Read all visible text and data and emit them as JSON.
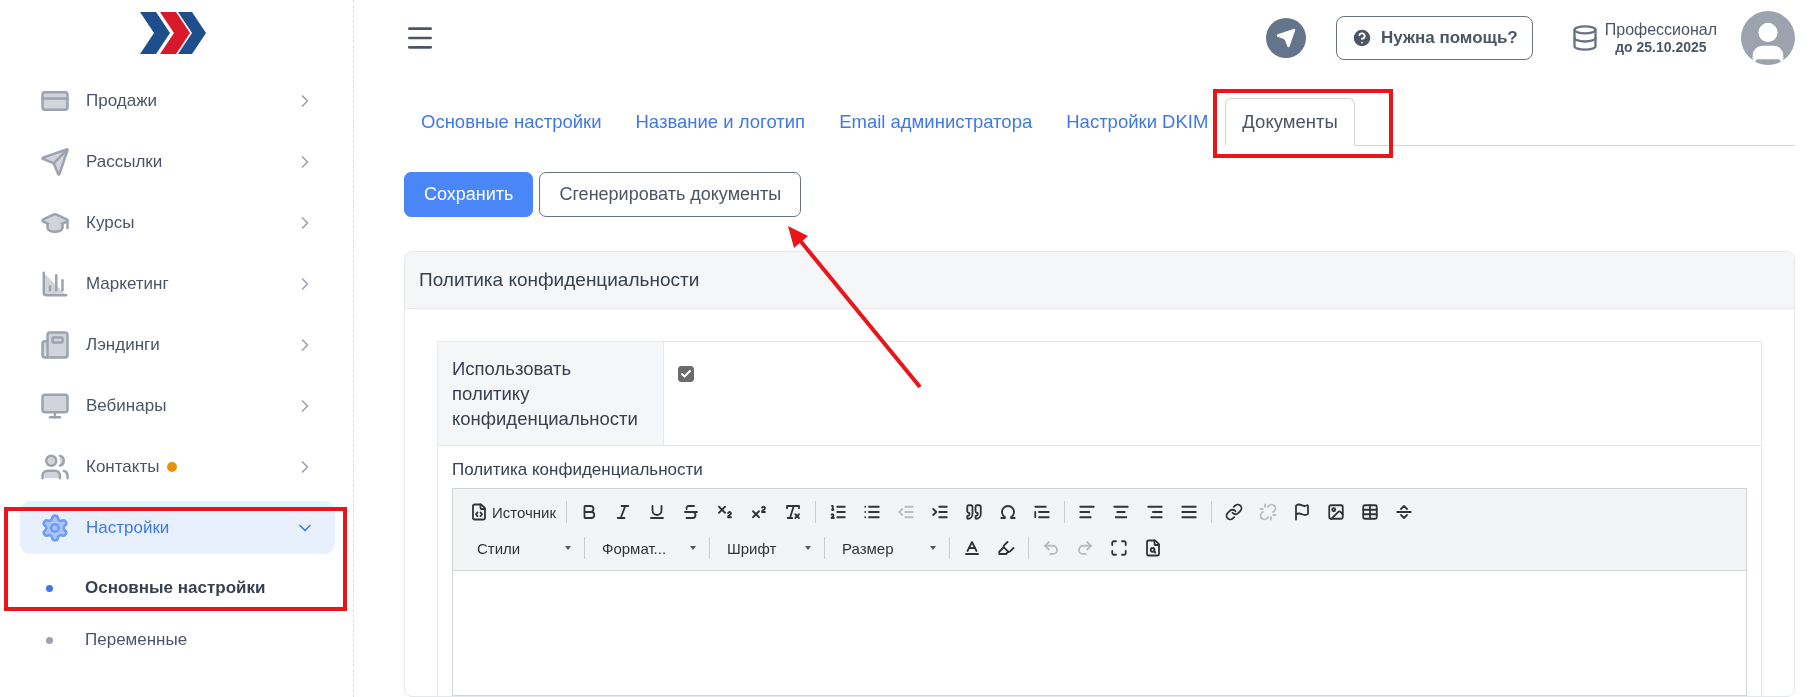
{
  "sidebar": {
    "items": [
      {
        "label": "Продажи",
        "expanded": false,
        "selected": false,
        "has_new": false
      },
      {
        "label": "Рассылки",
        "expanded": false,
        "selected": false,
        "has_new": false
      },
      {
        "label": "Курсы",
        "expanded": false,
        "selected": false,
        "has_new": false
      },
      {
        "label": "Маркетинг",
        "expanded": false,
        "selected": false,
        "has_new": false
      },
      {
        "label": "Лэндинги",
        "expanded": false,
        "selected": false,
        "has_new": false
      },
      {
        "label": "Вебинары",
        "expanded": false,
        "selected": false,
        "has_new": false
      },
      {
        "label": "Контакты",
        "expanded": false,
        "selected": false,
        "has_new": true
      },
      {
        "label": "Настройки",
        "expanded": true,
        "selected": true,
        "has_new": false,
        "children": [
          {
            "label": "Основные настройки",
            "selected": true
          },
          {
            "label": "Переменные",
            "selected": false
          }
        ]
      }
    ]
  },
  "header": {
    "help_button": "Нужна помощь?",
    "plan": {
      "name": "Профессионал",
      "until": "до 25.10.2025"
    }
  },
  "tabs": [
    {
      "label": "Основные настройки",
      "selected": false
    },
    {
      "label": "Название и логотип",
      "selected": false
    },
    {
      "label": "Email администратора",
      "selected": false
    },
    {
      "label": "Настройки DKIM",
      "selected": false
    },
    {
      "label": "Документы",
      "selected": true
    }
  ],
  "actions": [
    {
      "label": "Сохранить",
      "kind": "primary"
    },
    {
      "label": "Сгенерировать документы",
      "kind": "secondary"
    }
  ],
  "panel": {
    "title": "Политика конфиденциальности",
    "checkbox_row": {
      "label": "Использовать политику конфиденциальности",
      "checked": true
    },
    "editor": {
      "label": "Политика конфиденциальности",
      "toolbar": [
        [
          {
            "kind": "source",
            "label": "Источник",
            "disabled": false
          },
          {
            "kind": "sep"
          },
          {
            "kind": "bold",
            "disabled": false
          },
          {
            "kind": "italic",
            "disabled": false
          },
          {
            "kind": "underline",
            "disabled": false
          },
          {
            "kind": "strike",
            "disabled": false
          },
          {
            "kind": "sub",
            "disabled": false
          },
          {
            "kind": "sup",
            "disabled": false
          },
          {
            "kind": "clear",
            "disabled": false
          },
          {
            "kind": "sep"
          },
          {
            "kind": "ol",
            "disabled": false
          },
          {
            "kind": "ul",
            "disabled": false
          },
          {
            "kind": "outdent",
            "disabled": true
          },
          {
            "kind": "indent",
            "disabled": false
          },
          {
            "kind": "quote",
            "disabled": false
          },
          {
            "kind": "omega",
            "disabled": false
          },
          {
            "kind": "blocks",
            "disabled": false
          },
          {
            "kind": "sep"
          },
          {
            "kind": "left",
            "disabled": false
          },
          {
            "kind": "center",
            "disabled": false
          },
          {
            "kind": "right",
            "disabled": false
          },
          {
            "kind": "justify",
            "disabled": false
          },
          {
            "kind": "sep"
          },
          {
            "kind": "link",
            "disabled": false
          },
          {
            "kind": "unlink",
            "disabled": true
          },
          {
            "kind": "anchor",
            "disabled": false
          },
          {
            "kind": "image",
            "disabled": false
          },
          {
            "kind": "table",
            "disabled": false
          },
          {
            "kind": "hr",
            "disabled": false
          }
        ],
        [
          {
            "kind": "dropdown",
            "label": "Стили"
          },
          {
            "kind": "sep"
          },
          {
            "kind": "dropdown",
            "label": "Формат..."
          },
          {
            "kind": "sep"
          },
          {
            "kind": "dropdown",
            "label": "Шрифт"
          },
          {
            "kind": "sep"
          },
          {
            "kind": "dropdown",
            "label": "Размер"
          },
          {
            "kind": "sep"
          },
          {
            "kind": "textcolor",
            "disabled": false
          },
          {
            "kind": "bgcolor",
            "disabled": false
          },
          {
            "kind": "sep"
          },
          {
            "kind": "undo",
            "disabled": true
          },
          {
            "kind": "redo",
            "disabled": true
          },
          {
            "kind": "maximize",
            "disabled": false
          },
          {
            "kind": "preview",
            "disabled": false
          }
        ]
      ]
    }
  }
}
